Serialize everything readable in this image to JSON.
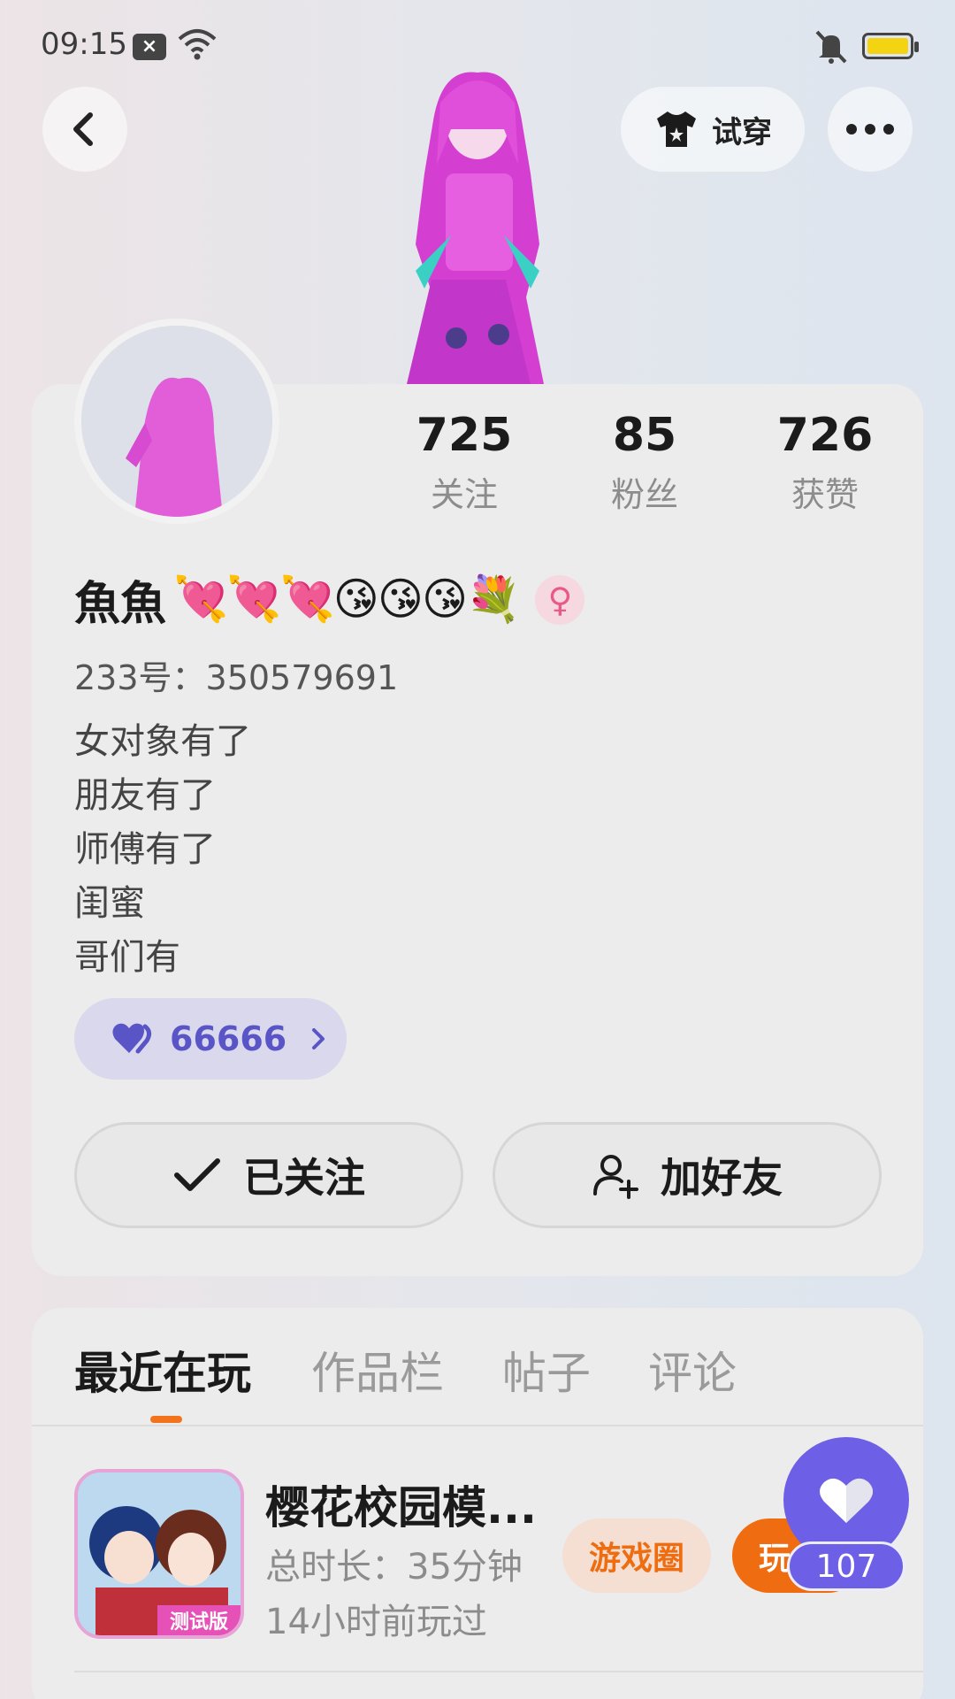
{
  "status_bar": {
    "time": "09:15"
  },
  "header": {
    "try_on_label": "试穿"
  },
  "profile": {
    "nickname": "魚魚",
    "nickname_emojis": "💘💘💘😘😘😘💐",
    "gender_symbol": "♀",
    "user_id": "233号：350579691",
    "bio_lines": [
      "女对象有了",
      "朋友有了",
      "师傅有了",
      "闺蜜",
      "哥们有"
    ],
    "stats": [
      {
        "value": "725",
        "label": "关注"
      },
      {
        "value": "85",
        "label": "粉丝"
      },
      {
        "value": "726",
        "label": "获赞"
      }
    ],
    "like_pill_value": "66666",
    "follow_button_label": "已关注",
    "add_friend_button_label": "加好友"
  },
  "tabs": [
    "最近在玩",
    "作品栏",
    "帖子",
    "评论"
  ],
  "game": {
    "title": "樱花校园模...",
    "duration": "总时长：35分钟",
    "last_played": "14小时前玩过",
    "icon_badge": "测试版",
    "circle_label": "游戏圈",
    "play_label": "玩"
  },
  "like_fab": {
    "count": "107"
  },
  "colors": {
    "accent_orange": "#f06c10",
    "accent_purple": "#6e60e6",
    "like_pill_text": "#5a55c6"
  }
}
